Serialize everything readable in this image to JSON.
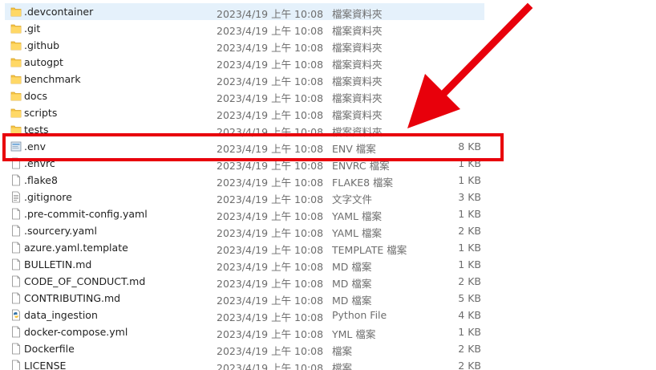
{
  "files": [
    {
      "name": ".devcontainer",
      "date": "2023/4/19 上午 10:08",
      "type": "檔案資料夾",
      "size": "",
      "icon": "folder-icon",
      "selected": true
    },
    {
      "name": ".git",
      "date": "2023/4/19 上午 10:08",
      "type": "檔案資料夾",
      "size": "",
      "icon": "folder-icon"
    },
    {
      "name": ".github",
      "date": "2023/4/19 上午 10:08",
      "type": "檔案資料夾",
      "size": "",
      "icon": "folder-icon"
    },
    {
      "name": "autogpt",
      "date": "2023/4/19 上午 10:08",
      "type": "檔案資料夾",
      "size": "",
      "icon": "folder-icon"
    },
    {
      "name": "benchmark",
      "date": "2023/4/19 上午 10:08",
      "type": "檔案資料夾",
      "size": "",
      "icon": "folder-icon"
    },
    {
      "name": "docs",
      "date": "2023/4/19 上午 10:08",
      "type": "檔案資料夾",
      "size": "",
      "icon": "folder-icon"
    },
    {
      "name": "scripts",
      "date": "2023/4/19 上午 10:08",
      "type": "檔案資料夾",
      "size": "",
      "icon": "folder-icon"
    },
    {
      "name": "tests",
      "date": "2023/4/19 上午 10:08",
      "type": "檔案資料夾",
      "size": "",
      "icon": "folder-icon"
    },
    {
      "name": ".env",
      "date": "2023/4/19 上午 10:08",
      "type": "ENV 檔案",
      "size": "8 KB",
      "icon": "env-file-icon",
      "highlighted": true
    },
    {
      "name": ".envrc",
      "date": "2023/4/19 上午 10:08",
      "type": "ENVRC 檔案",
      "size": "1 KB",
      "icon": "file-icon"
    },
    {
      "name": ".flake8",
      "date": "2023/4/19 上午 10:08",
      "type": "FLAKE8 檔案",
      "size": "1 KB",
      "icon": "file-icon"
    },
    {
      "name": ".gitignore",
      "date": "2023/4/19 上午 10:08",
      "type": "文字文件",
      "size": "3 KB",
      "icon": "text-file-icon"
    },
    {
      "name": ".pre-commit-config.yaml",
      "date": "2023/4/19 上午 10:08",
      "type": "YAML 檔案",
      "size": "1 KB",
      "icon": "file-icon"
    },
    {
      "name": ".sourcery.yaml",
      "date": "2023/4/19 上午 10:08",
      "type": "YAML 檔案",
      "size": "2 KB",
      "icon": "file-icon"
    },
    {
      "name": "azure.yaml.template",
      "date": "2023/4/19 上午 10:08",
      "type": "TEMPLATE 檔案",
      "size": "1 KB",
      "icon": "file-icon"
    },
    {
      "name": "BULLETIN.md",
      "date": "2023/4/19 上午 10:08",
      "type": "MD 檔案",
      "size": "1 KB",
      "icon": "file-icon"
    },
    {
      "name": "CODE_OF_CONDUCT.md",
      "date": "2023/4/19 上午 10:08",
      "type": "MD 檔案",
      "size": "2 KB",
      "icon": "file-icon"
    },
    {
      "name": "CONTRIBUTING.md",
      "date": "2023/4/19 上午 10:08",
      "type": "MD 檔案",
      "size": "5 KB",
      "icon": "file-icon"
    },
    {
      "name": "data_ingestion",
      "date": "2023/4/19 上午 10:08",
      "type": "Python File",
      "size": "4 KB",
      "icon": "python-file-icon"
    },
    {
      "name": "docker-compose.yml",
      "date": "2023/4/19 上午 10:08",
      "type": "YML 檔案",
      "size": "1 KB",
      "icon": "file-icon"
    },
    {
      "name": "Dockerfile",
      "date": "2023/4/19 上午 10:08",
      "type": "檔案",
      "size": "2 KB",
      "icon": "file-icon"
    },
    {
      "name": "LICENSE",
      "date": "2023/4/19 上午 10:08",
      "type": "檔案",
      "size": "2 KB",
      "icon": "file-icon"
    }
  ],
  "colors": {
    "annotation": "#e8000b",
    "selection": "#e5f1fb",
    "folder": "#f5c443"
  }
}
